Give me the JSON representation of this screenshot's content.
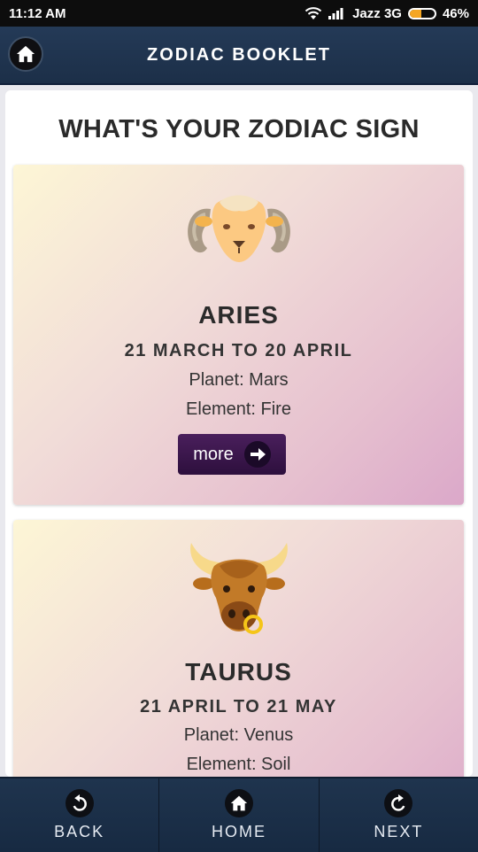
{
  "status_bar": {
    "time": "11:12 AM",
    "carrier": "Jazz 3G",
    "battery_percent": "46%",
    "battery_level": 0.46,
    "icons": [
      "wifi-icon",
      "signal-icon",
      "battery-icon"
    ]
  },
  "header": {
    "title": "ZODIAC BOOKLET",
    "home_icon": "home-icon"
  },
  "main": {
    "title": "WHAT'S YOUR ZODIAC SIGN",
    "signs": [
      {
        "name": "ARIES",
        "dates": "21 MARCH TO 20 APRIL",
        "planet": "Planet: Mars",
        "element": "Element: Fire",
        "more_label": "more",
        "icon": "ram-icon"
      },
      {
        "name": "TAURUS",
        "dates": "21 APRIL TO 21 MAY",
        "planet": "Planet: Venus",
        "element": "Element: Soil",
        "icon": "bull-icon"
      }
    ]
  },
  "bottom_nav": {
    "back": "BACK",
    "home": "HOME",
    "next": "NEXT"
  },
  "colors": {
    "header": "#1f344e",
    "more_button": "#3a1650",
    "card_gradient_start": "#fdf6d6",
    "card_gradient_end": "#dba8c9"
  }
}
